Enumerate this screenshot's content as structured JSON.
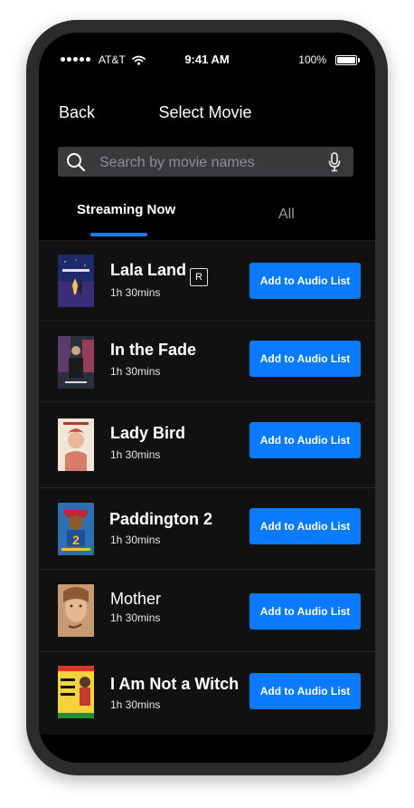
{
  "status": {
    "carrier": "AT&T",
    "time": "9:41 AM",
    "battery": "100%"
  },
  "nav": {
    "back": "Back",
    "title": "Select Movie"
  },
  "search": {
    "placeholder": "Search by movie names",
    "value": ""
  },
  "tabs": [
    {
      "label": "Streaming Now",
      "active": true
    },
    {
      "label": "All",
      "active": false
    }
  ],
  "movies": [
    {
      "title": "Lala Land",
      "duration": "1h 30mins",
      "rating": "R",
      "action": "Add to Audio List"
    },
    {
      "title": "In the Fade",
      "duration": "1h 30mins",
      "action": "Add to Audio List"
    },
    {
      "title": "Lady Bird",
      "duration": "1h 30mins",
      "action": "Add to Audio List"
    },
    {
      "title": "Paddington 2",
      "duration": "1h 30mins",
      "action": "Add to Audio List"
    },
    {
      "title": "Mother",
      "duration": "1h 30mins",
      "action": "Add to Audio List"
    },
    {
      "title": "I Am Not a Witch",
      "duration": "1h 30mins",
      "action": "Add to Audio List"
    }
  ],
  "colors": {
    "accent": "#0a7aff",
    "tab_indicator": "#1d7bf5",
    "list_bg": "#111111"
  }
}
